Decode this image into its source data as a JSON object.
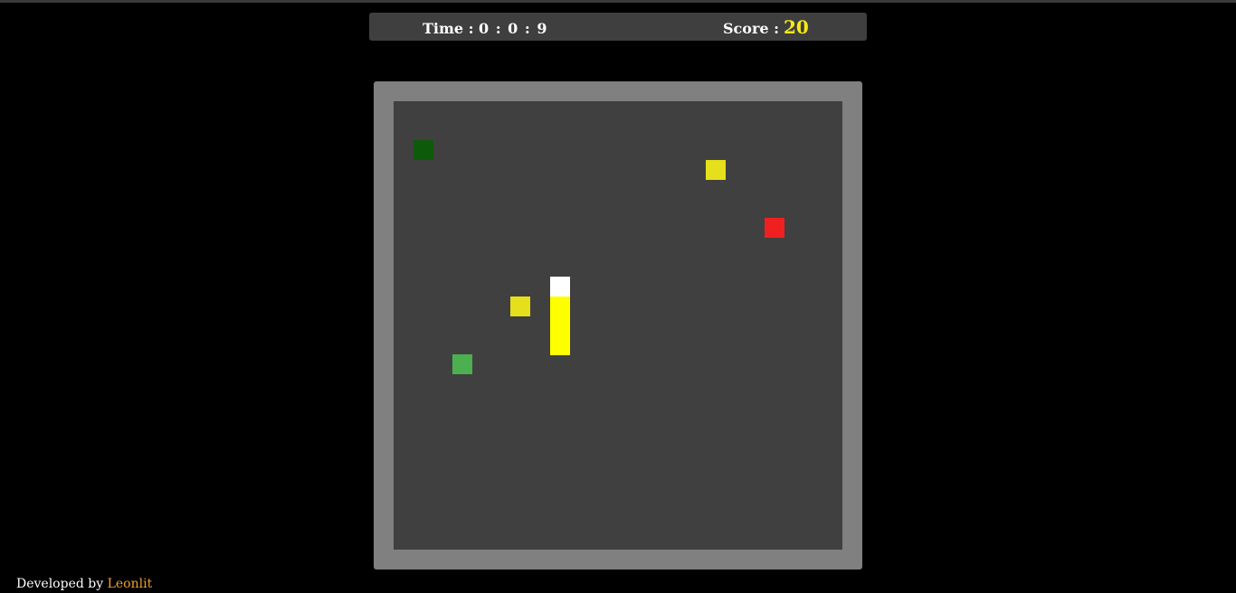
{
  "hud": {
    "time_label": "Time :",
    "time_value": "0 : 0 : 9",
    "score_label": "Score :",
    "score_value": "20"
  },
  "board": {
    "grid_size": 23,
    "background_color": "#404040",
    "frame_color": "#808080",
    "snake": {
      "head": {
        "col": 8,
        "row": 9,
        "color": "#ffffff"
      },
      "body": [
        {
          "col": 8,
          "row": 10
        },
        {
          "col": 8,
          "row": 11
        },
        {
          "col": 8,
          "row": 12
        }
      ],
      "body_color": "#ffff00"
    },
    "items": [
      {
        "kind": "dark-green-block",
        "col": 1,
        "row": 2,
        "color": "#0d5a0a"
      },
      {
        "kind": "yellow-food",
        "col": 16,
        "row": 3,
        "color": "#e6df1c"
      },
      {
        "kind": "red-block",
        "col": 19,
        "row": 6,
        "color": "#f02020"
      },
      {
        "kind": "yellow-food",
        "col": 6,
        "row": 10,
        "color": "#e6df1c"
      },
      {
        "kind": "green-block",
        "col": 3,
        "row": 13,
        "color": "#4caf50"
      }
    ]
  },
  "footer": {
    "prefix": "Developed by",
    "author": "Leonlit"
  }
}
